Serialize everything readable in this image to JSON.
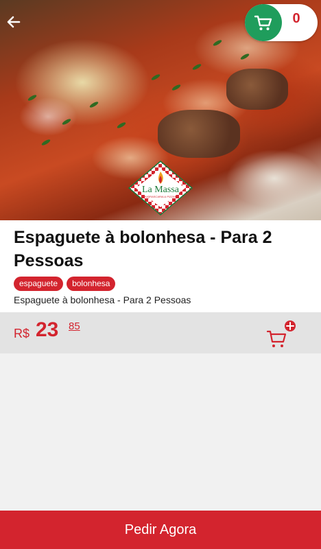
{
  "header": {
    "back_icon": "arrow-left-icon",
    "cart_icon": "shopping-cart-icon",
    "cart_count": "0",
    "accent_green": "#1f9d5c"
  },
  "logo": {
    "name": "La Massa",
    "tagline": "CHURRASCARIA & PIZZARIA"
  },
  "product": {
    "title": "Espaguete à bolonhesa - Para 2 Pessoas",
    "tags": [
      "espaguete",
      "bolonhesa"
    ],
    "description": "Espaguete à bolonhesa - Para 2 Pessoas"
  },
  "price": {
    "currency": "R$",
    "integer": "23",
    "decimal": "85",
    "add_to_cart_icon": "cart-plus-icon"
  },
  "footer": {
    "order_label": "Pedir Agora"
  },
  "colors": {
    "accent_red": "#d3242e"
  }
}
